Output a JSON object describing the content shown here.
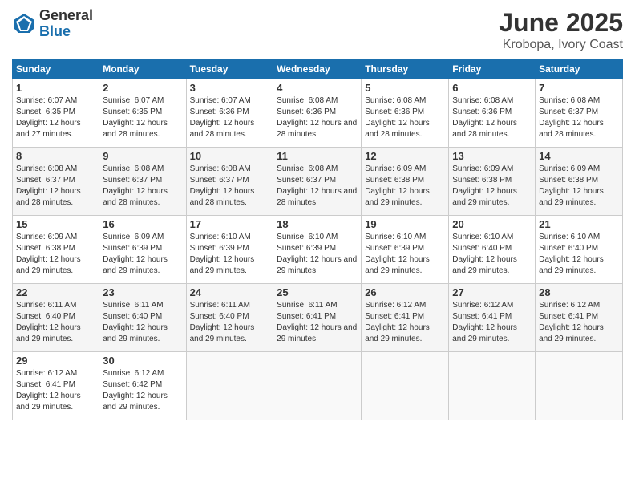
{
  "logo": {
    "general": "General",
    "blue": "Blue"
  },
  "title": "June 2025",
  "subtitle": "Krobopa, Ivory Coast",
  "days_header": [
    "Sunday",
    "Monday",
    "Tuesday",
    "Wednesday",
    "Thursday",
    "Friday",
    "Saturday"
  ],
  "weeks": [
    [
      {
        "day": "1",
        "sunrise": "Sunrise: 6:07 AM",
        "sunset": "Sunset: 6:35 PM",
        "daylight": "Daylight: 12 hours and 27 minutes."
      },
      {
        "day": "2",
        "sunrise": "Sunrise: 6:07 AM",
        "sunset": "Sunset: 6:35 PM",
        "daylight": "Daylight: 12 hours and 28 minutes."
      },
      {
        "day": "3",
        "sunrise": "Sunrise: 6:07 AM",
        "sunset": "Sunset: 6:36 PM",
        "daylight": "Daylight: 12 hours and 28 minutes."
      },
      {
        "day": "4",
        "sunrise": "Sunrise: 6:08 AM",
        "sunset": "Sunset: 6:36 PM",
        "daylight": "Daylight: 12 hours and 28 minutes."
      },
      {
        "day": "5",
        "sunrise": "Sunrise: 6:08 AM",
        "sunset": "Sunset: 6:36 PM",
        "daylight": "Daylight: 12 hours and 28 minutes."
      },
      {
        "day": "6",
        "sunrise": "Sunrise: 6:08 AM",
        "sunset": "Sunset: 6:36 PM",
        "daylight": "Daylight: 12 hours and 28 minutes."
      },
      {
        "day": "7",
        "sunrise": "Sunrise: 6:08 AM",
        "sunset": "Sunset: 6:37 PM",
        "daylight": "Daylight: 12 hours and 28 minutes."
      }
    ],
    [
      {
        "day": "8",
        "sunrise": "Sunrise: 6:08 AM",
        "sunset": "Sunset: 6:37 PM",
        "daylight": "Daylight: 12 hours and 28 minutes."
      },
      {
        "day": "9",
        "sunrise": "Sunrise: 6:08 AM",
        "sunset": "Sunset: 6:37 PM",
        "daylight": "Daylight: 12 hours and 28 minutes."
      },
      {
        "day": "10",
        "sunrise": "Sunrise: 6:08 AM",
        "sunset": "Sunset: 6:37 PM",
        "daylight": "Daylight: 12 hours and 28 minutes."
      },
      {
        "day": "11",
        "sunrise": "Sunrise: 6:08 AM",
        "sunset": "Sunset: 6:37 PM",
        "daylight": "Daylight: 12 hours and 28 minutes."
      },
      {
        "day": "12",
        "sunrise": "Sunrise: 6:09 AM",
        "sunset": "Sunset: 6:38 PM",
        "daylight": "Daylight: 12 hours and 29 minutes."
      },
      {
        "day": "13",
        "sunrise": "Sunrise: 6:09 AM",
        "sunset": "Sunset: 6:38 PM",
        "daylight": "Daylight: 12 hours and 29 minutes."
      },
      {
        "day": "14",
        "sunrise": "Sunrise: 6:09 AM",
        "sunset": "Sunset: 6:38 PM",
        "daylight": "Daylight: 12 hours and 29 minutes."
      }
    ],
    [
      {
        "day": "15",
        "sunrise": "Sunrise: 6:09 AM",
        "sunset": "Sunset: 6:38 PM",
        "daylight": "Daylight: 12 hours and 29 minutes."
      },
      {
        "day": "16",
        "sunrise": "Sunrise: 6:09 AM",
        "sunset": "Sunset: 6:39 PM",
        "daylight": "Daylight: 12 hours and 29 minutes."
      },
      {
        "day": "17",
        "sunrise": "Sunrise: 6:10 AM",
        "sunset": "Sunset: 6:39 PM",
        "daylight": "Daylight: 12 hours and 29 minutes."
      },
      {
        "day": "18",
        "sunrise": "Sunrise: 6:10 AM",
        "sunset": "Sunset: 6:39 PM",
        "daylight": "Daylight: 12 hours and 29 minutes."
      },
      {
        "day": "19",
        "sunrise": "Sunrise: 6:10 AM",
        "sunset": "Sunset: 6:39 PM",
        "daylight": "Daylight: 12 hours and 29 minutes."
      },
      {
        "day": "20",
        "sunrise": "Sunrise: 6:10 AM",
        "sunset": "Sunset: 6:40 PM",
        "daylight": "Daylight: 12 hours and 29 minutes."
      },
      {
        "day": "21",
        "sunrise": "Sunrise: 6:10 AM",
        "sunset": "Sunset: 6:40 PM",
        "daylight": "Daylight: 12 hours and 29 minutes."
      }
    ],
    [
      {
        "day": "22",
        "sunrise": "Sunrise: 6:11 AM",
        "sunset": "Sunset: 6:40 PM",
        "daylight": "Daylight: 12 hours and 29 minutes."
      },
      {
        "day": "23",
        "sunrise": "Sunrise: 6:11 AM",
        "sunset": "Sunset: 6:40 PM",
        "daylight": "Daylight: 12 hours and 29 minutes."
      },
      {
        "day": "24",
        "sunrise": "Sunrise: 6:11 AM",
        "sunset": "Sunset: 6:40 PM",
        "daylight": "Daylight: 12 hours and 29 minutes."
      },
      {
        "day": "25",
        "sunrise": "Sunrise: 6:11 AM",
        "sunset": "Sunset: 6:41 PM",
        "daylight": "Daylight: 12 hours and 29 minutes."
      },
      {
        "day": "26",
        "sunrise": "Sunrise: 6:12 AM",
        "sunset": "Sunset: 6:41 PM",
        "daylight": "Daylight: 12 hours and 29 minutes."
      },
      {
        "day": "27",
        "sunrise": "Sunrise: 6:12 AM",
        "sunset": "Sunset: 6:41 PM",
        "daylight": "Daylight: 12 hours and 29 minutes."
      },
      {
        "day": "28",
        "sunrise": "Sunrise: 6:12 AM",
        "sunset": "Sunset: 6:41 PM",
        "daylight": "Daylight: 12 hours and 29 minutes."
      }
    ],
    [
      {
        "day": "29",
        "sunrise": "Sunrise: 6:12 AM",
        "sunset": "Sunset: 6:41 PM",
        "daylight": "Daylight: 12 hours and 29 minutes."
      },
      {
        "day": "30",
        "sunrise": "Sunrise: 6:12 AM",
        "sunset": "Sunset: 6:42 PM",
        "daylight": "Daylight: 12 hours and 29 minutes."
      },
      null,
      null,
      null,
      null,
      null
    ]
  ]
}
